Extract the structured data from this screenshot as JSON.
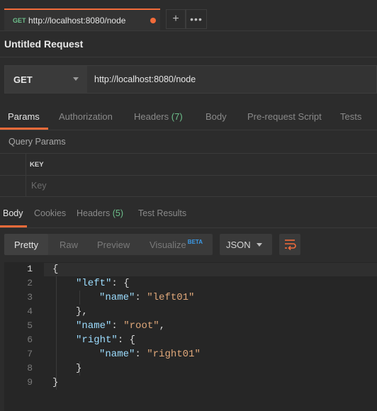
{
  "tab": {
    "method": "GET",
    "url": "http://localhost:8080/node"
  },
  "request": {
    "title": "Untitled Request",
    "method": "GET",
    "url": "http://localhost:8080/node"
  },
  "request_tabs": [
    {
      "label": "Params",
      "active": true
    },
    {
      "label": "Authorization"
    },
    {
      "label": "Headers",
      "count": "(7)"
    },
    {
      "label": "Body"
    },
    {
      "label": "Pre-request Script"
    },
    {
      "label": "Tests"
    }
  ],
  "query_params": {
    "title": "Query Params",
    "key_header": "KEY",
    "key_placeholder": "Key"
  },
  "response_tabs": [
    {
      "label": "Body",
      "active": true
    },
    {
      "label": "Cookies"
    },
    {
      "label": "Headers",
      "count": "(5)"
    },
    {
      "label": "Test Results"
    }
  ],
  "view_modes": [
    {
      "label": "Pretty",
      "active": true
    },
    {
      "label": "Raw"
    },
    {
      "label": "Preview"
    },
    {
      "label": "Visualize",
      "badge": "BETA"
    }
  ],
  "format": "JSON",
  "editor": {
    "line_numbers": [
      "1",
      "2",
      "3",
      "4",
      "5",
      "6",
      "7",
      "8",
      "9"
    ],
    "lines": [
      [
        {
          "t": "p",
          "v": "{"
        }
      ],
      [
        {
          "t": "k",
          "v": "\"left\""
        },
        {
          "t": "p",
          "v": ": {"
        }
      ],
      [
        {
          "t": "k",
          "v": "\"name\""
        },
        {
          "t": "p",
          "v": ": "
        },
        {
          "t": "s",
          "v": "\"left01\""
        }
      ],
      [
        {
          "t": "p",
          "v": "},"
        }
      ],
      [
        {
          "t": "k",
          "v": "\"name\""
        },
        {
          "t": "p",
          "v": ": "
        },
        {
          "t": "s",
          "v": "\"root\""
        },
        {
          "t": "p",
          "v": ","
        }
      ],
      [
        {
          "t": "k",
          "v": "\"right\""
        },
        {
          "t": "p",
          "v": ": {"
        }
      ],
      [
        {
          "t": "k",
          "v": "\"name\""
        },
        {
          "t": "p",
          "v": ": "
        },
        {
          "t": "s",
          "v": "\"right01\""
        }
      ],
      [
        {
          "t": "p",
          "v": "}"
        }
      ],
      [
        {
          "t": "p",
          "v": "}"
        }
      ]
    ]
  },
  "colors": {
    "accent": "#f26b3a",
    "count_green": "#6dbf8b",
    "beta_blue": "#3b9ae8",
    "json_key": "#9cdcfe",
    "json_string": "#e0a87a"
  },
  "icons": {
    "add": "plus-icon",
    "more": "more-icon",
    "wrap": "wrap-lines-icon",
    "caret": "chevron-down-icon"
  }
}
